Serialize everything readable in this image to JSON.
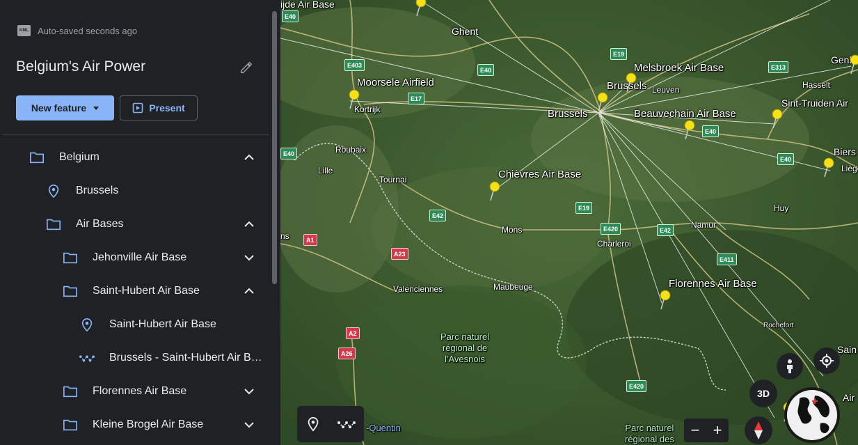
{
  "header": {
    "autosave_text": "Auto-saved seconds ago",
    "kml_label": "KML",
    "project_title": "Belgium's Air Power",
    "new_feature_label": "New feature",
    "present_label": "Present"
  },
  "tree": [
    {
      "label": "Belgium",
      "type": "folder",
      "state": "expanded"
    },
    {
      "label": "Brussels",
      "type": "placemark"
    },
    {
      "label": "Air Bases",
      "type": "folder",
      "state": "expanded"
    },
    {
      "label": "Jehonville Air Base",
      "type": "folder",
      "state": "collapsed"
    },
    {
      "label": "Saint-Hubert Air Base",
      "type": "folder",
      "state": "expanded"
    },
    {
      "label": "Saint-Hubert Air Base",
      "type": "placemark"
    },
    {
      "label": "Brussels - Saint-Hubert Air B…",
      "type": "path"
    },
    {
      "label": "Florennes Air Base",
      "type": "folder",
      "state": "collapsed"
    },
    {
      "label": "Kleine Brogel Air Base",
      "type": "folder",
      "state": "collapsed"
    }
  ],
  "map": {
    "labels": {
      "gijde_air_base": "ijde Air Base",
      "ghent": "Ghent",
      "melsbroek": "Melsbroek Air Base",
      "genk": "Genk",
      "moorsele": "Moorsele Airfield",
      "brussels_upper": "Brussels",
      "leuven": "Leuven",
      "hasselt": "Hasselt",
      "kortrijk": "Kortrijk",
      "brussels": "Brussels",
      "beauvechain": "Beauvechain Air Base",
      "sint_truiden": "Sint-Truiden Air",
      "roubaix": "Roubaix",
      "biers": "Biers",
      "lille": "Lille",
      "tournai": "Tournai",
      "chievres": "Chièvres Air Base",
      "liege": "Liège",
      "huy": "Huy",
      "mons": "Mons",
      "namur": "Namur",
      "ns": "ns",
      "charleroi": "Charleroi",
      "valenciennes": "Valenciennes",
      "maubeuge": "Maubeuge",
      "florennes": "Florennes Air Base",
      "rochefort": "Rochefort",
      "park_avesnois": "Parc naturel\nrégional de\nl'Avesnois",
      "saint_quentin": "-Quentin",
      "park_bottom": "Parc naturel\nrégional des",
      "sain": "Sain",
      "air": "Air"
    },
    "shields": {
      "e40_tl": "E40",
      "e403": "E403",
      "e40_a": "E40",
      "e19_top": "E19",
      "e313": "E313",
      "e17": "E17",
      "e40_b": "E40",
      "e40_c": "E40",
      "e40_d": "E40",
      "e42_a": "E42",
      "e19": "E19",
      "e420": "E420",
      "e42_b": "E42",
      "a1": "A1",
      "a23": "A23",
      "e411": "E411",
      "a2": "A2",
      "a26": "A26",
      "e420_b": "E420"
    },
    "controls": {
      "btn_3d": "3D",
      "zoom_out": "−",
      "zoom_in": "+"
    }
  },
  "colors": {
    "sidebar_bg": "#202124",
    "accent": "#8ab4f8",
    "pin": "#f4e11a"
  }
}
